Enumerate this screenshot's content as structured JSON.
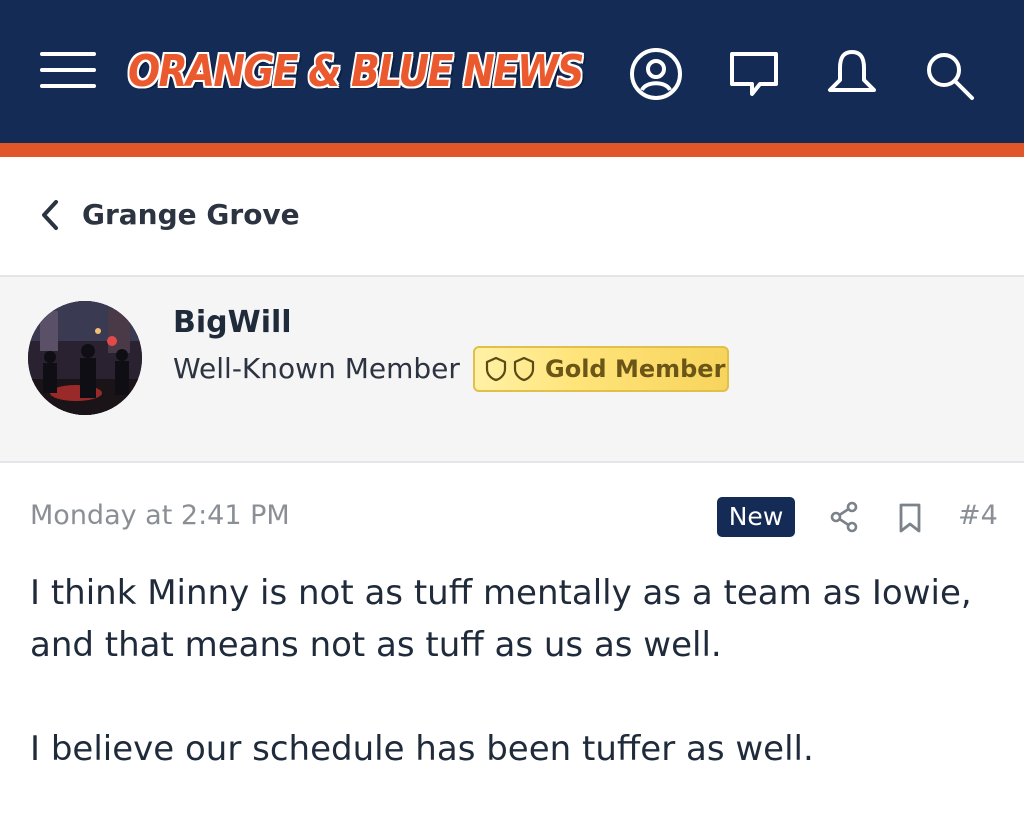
{
  "header": {
    "logo_text": "ORANGE & BLUE NEWS",
    "colors": {
      "bar": "#142b55",
      "accent": "#e2572a"
    },
    "icons": [
      "menu-icon",
      "account-icon",
      "messages-icon",
      "notifications-icon",
      "search-icon"
    ]
  },
  "breadcrumb": {
    "back_icon": "chevron-left-icon",
    "label": "Grange Grove"
  },
  "author": {
    "name": "BigWill",
    "title": "Well-Known Member",
    "badge": {
      "label": "Gold Member",
      "icons": [
        "shield-icon",
        "shield-icon"
      ]
    }
  },
  "post": {
    "timestamp": "Monday at 2:41 PM",
    "new_label": "New",
    "actions": [
      "share-icon",
      "bookmark-icon"
    ],
    "number": "#4",
    "paragraphs": [
      "I think Minny is not as tuff mentally as a team as Iowie, and that means not as tuff as us as well.",
      "I believe our schedule has been tuffer as well."
    ]
  }
}
